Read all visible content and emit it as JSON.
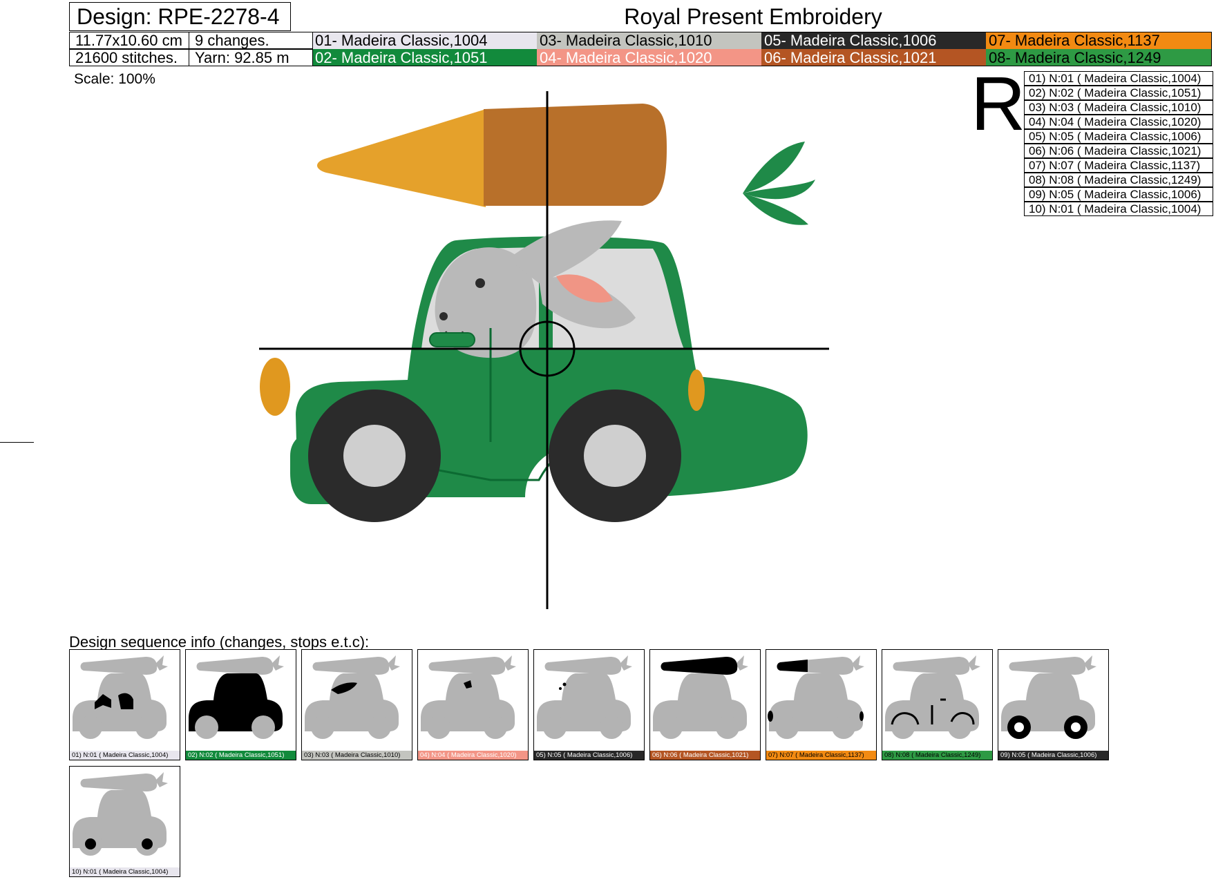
{
  "header": {
    "design_label": "Design: RPE-2278-4",
    "company": "Royal Present Embroidery",
    "size": "11.77x10.60 cm",
    "changes": "9 changes.",
    "stitches": "21600 stitches.",
    "yarn": "Yarn: 92.85 m"
  },
  "threads": [
    {
      "label": "01- Madeira Classic,1004",
      "bg": "#e8e6ee",
      "fg": "#000000"
    },
    {
      "label": "02- Madeira Classic,1051",
      "bg": "#128a3c",
      "fg": "#ffffff"
    },
    {
      "label": "03- Madeira Classic,1010",
      "bg": "#c3c4bf",
      "fg": "#000000"
    },
    {
      "label": "04- Madeira Classic,1020",
      "bg": "#f39586",
      "fg": "#ffffff"
    },
    {
      "label": "05- Madeira Classic,1006",
      "bg": "#282828",
      "fg": "#ffffff"
    },
    {
      "label": "06- Madeira Classic,1021",
      "bg": "#b45523",
      "fg": "#ffffff"
    },
    {
      "label": "07- Madeira Classic,1137",
      "bg": "#f28a12",
      "fg": "#000000"
    },
    {
      "label": "08- Madeira Classic,1249",
      "bg": "#2e9a44",
      "fg": "#000000"
    }
  ],
  "scale_label": "Scale: 100%",
  "rotation_mark": "R",
  "stop_list": [
    "01) N:01 ( Madeira Classic,1004)",
    "02) N:02 ( Madeira Classic,1051)",
    "03) N:03 ( Madeira Classic,1010)",
    "04) N:04 ( Madeira Classic,1020)",
    "05) N:05 ( Madeira Classic,1006)",
    "06) N:06 ( Madeira Classic,1021)",
    "07) N:07 ( Madeira Classic,1137)",
    "08) N:08 ( Madeira Classic,1249)",
    "09) N:05 ( Madeira Classic,1006)",
    "10) N:01 ( Madeira Classic,1004)"
  ],
  "sequence_label": "Design sequence info (changes, stops e.t.c):",
  "sequence": [
    {
      "caption": "01) N:01 ( Madeira Classic,1004)",
      "bg": "#e8e6ee",
      "fg": "#000000",
      "highlight": "windows"
    },
    {
      "caption": "02) N:02 ( Madeira Classic,1051)",
      "bg": "#128a3c",
      "fg": "#ffffff",
      "highlight": "body"
    },
    {
      "caption": "03) N:03 ( Madeira Classic,1010)",
      "bg": "#c3c4bf",
      "fg": "#000000",
      "highlight": "ear"
    },
    {
      "caption": "04) N:04 ( Madeira Classic,1020)",
      "bg": "#f39586",
      "fg": "#ffffff",
      "highlight": "inner-ear"
    },
    {
      "caption": "05) N:05 ( Madeira Classic,1006)",
      "bg": "#282828",
      "fg": "#ffffff",
      "highlight": "face"
    },
    {
      "caption": "06) N:06 ( Madeira Classic,1021)",
      "bg": "#b45523",
      "fg": "#ffffff",
      "highlight": "carrot-right"
    },
    {
      "caption": "07) N:07 ( Madeira Classic,1137)",
      "bg": "#f28a12",
      "fg": "#000000",
      "highlight": "carrot-lights"
    },
    {
      "caption": "08) N:08 ( Madeira Classic,1249)",
      "bg": "#2e9a44",
      "fg": "#000000",
      "highlight": "lines"
    },
    {
      "caption": "09) N:05 ( Madeira Classic,1006)",
      "bg": "#282828",
      "fg": "#ffffff",
      "highlight": "tires"
    },
    {
      "caption": "10) N:01 ( Madeira Classic,1004)",
      "bg": "#e8e6ee",
      "fg": "#000000",
      "highlight": "hubs"
    }
  ],
  "colors": {
    "car_green": "#1f8a48",
    "carrot_light": "#e5a12b",
    "carrot_dark": "#b8702a",
    "leaf_green": "#1f8a48",
    "bunny_gray": "#b9b9b9",
    "window_gray": "#dcdcdc",
    "ear_pink": "#f09585",
    "tire_black": "#2b2b2b",
    "hub_gray": "#cfcfcf",
    "light_orange": "#e0981f",
    "silhouette": "#b3b3b3"
  }
}
